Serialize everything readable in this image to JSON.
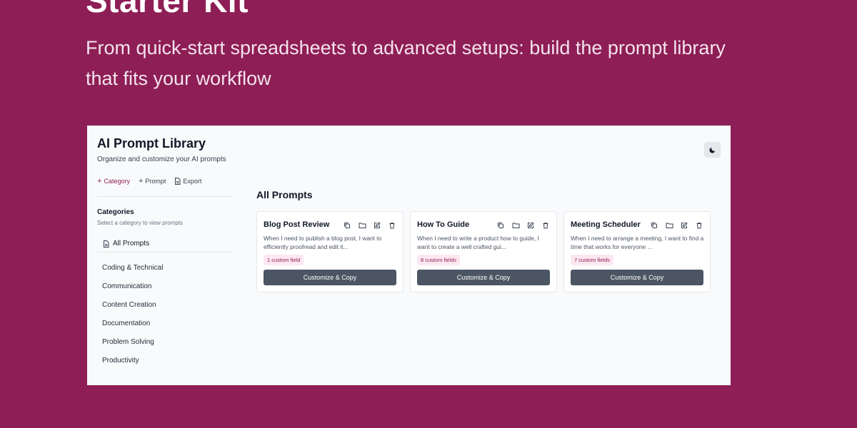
{
  "hero": {
    "title": "Starter Kit",
    "subtitle": "From quick-start spreadsheets to advanced setups: build the prompt library that fits your workflow"
  },
  "app": {
    "title": "AI Prompt Library",
    "subtitle": "Organize and customize your AI prompts",
    "theme_toggle_icon": "moon-icon",
    "toolbar": {
      "category_label": "Category",
      "prompt_label": "Prompt",
      "export_label": "Export"
    },
    "sidebar": {
      "heading": "Categories",
      "hint": "Select a category to view prompts",
      "all_prompts_label": "All Prompts",
      "categories": [
        "Coding & Technical",
        "Communication",
        "Content Creation",
        "Documentation",
        "Problem Solving",
        "Productivity"
      ]
    },
    "main": {
      "heading": "All Prompts",
      "cards": [
        {
          "title": "Blog Post Review",
          "description": "When I need to publish a blog post, I want to efficiently proofread and edit it...",
          "badge": "1 custom field",
          "button": "Customize & Copy"
        },
        {
          "title": "How To Guide",
          "description": "When I need to write a product how to guide, I want to create a well crafted gui...",
          "badge": "8 custom fields",
          "button": "Customize & Copy"
        },
        {
          "title": "Meeting Scheduler",
          "description": "When I need to arrange a meeting, I want to find a time that works for everyone ...",
          "badge": "7 custom fields",
          "button": "Customize & Copy"
        }
      ]
    }
  },
  "colors": {
    "background": "#8e1e56",
    "accent": "#8e1e56",
    "button": "#4b5563",
    "badge_bg": "#fce7f0"
  }
}
